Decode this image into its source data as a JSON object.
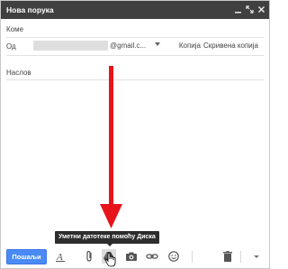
{
  "window": {
    "title": "Нова порука"
  },
  "compose": {
    "to_label": "Коме",
    "from_label": "Од",
    "from_email_suffix": "@gmail.c...",
    "cc_label": "Копија",
    "bcc_label": "Скривена копија",
    "subject_placeholder": "Наслов"
  },
  "tooltip": {
    "text": "Уметни датотеке помоћу Диска"
  },
  "toolbar": {
    "send_label": "Пошаљи",
    "icons": [
      "formatting-icon",
      "attach-icon",
      "drive-icon",
      "photo-icon",
      "link-icon",
      "emoji-icon",
      "trash-icon",
      "more-options-icon"
    ]
  },
  "colors": {
    "titlebar": "#404040",
    "send_button": "#4a8af4",
    "annotation_arrow": "#e8141c",
    "tooltip_bg": "#2d2d2d"
  }
}
